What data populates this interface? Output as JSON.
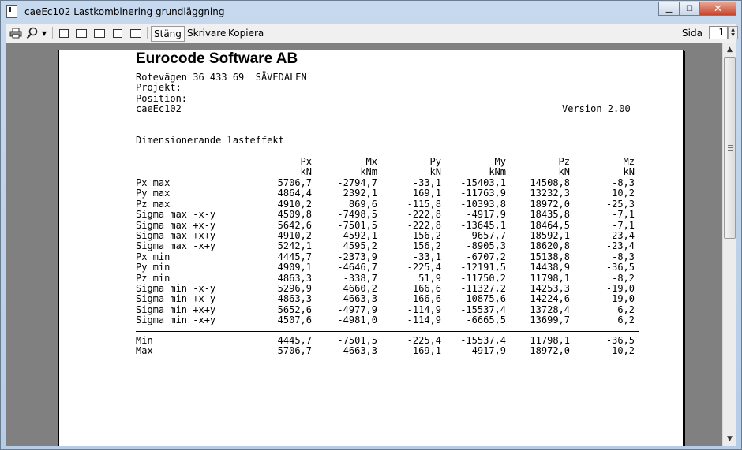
{
  "window": {
    "title": "caeEc102 Lastkombinering grundläggning"
  },
  "toolbar": {
    "close_label": "Stäng",
    "print_label": "Skrivare",
    "copy_label": "Kopiera",
    "page_label": "Sida",
    "page_value": "1"
  },
  "report": {
    "company": "Eurocode Software AB",
    "address": "Rotevägen 36 433 69  SÄVEDALEN",
    "project": "Projekt:",
    "position": "Position:",
    "program": "caeEc102",
    "version": "Version 2.00",
    "section_title": "Dimensionerande lasteffekt",
    "columns": [
      {
        "name": "Px",
        "unit": "kN"
      },
      {
        "name": "Mx",
        "unit": "kNm"
      },
      {
        "name": "Py",
        "unit": "kN"
      },
      {
        "name": "My",
        "unit": "kNm"
      },
      {
        "name": "Pz",
        "unit": "kN"
      },
      {
        "name": "Mz",
        "unit": "kN"
      }
    ],
    "rows": [
      {
        "label": "Px max",
        "values": [
          "5706,7",
          "-2794,7",
          "-33,1",
          "-15403,1",
          "14508,8",
          "-8,3"
        ]
      },
      {
        "label": "Py max",
        "values": [
          "4864,4",
          "2392,1",
          "169,1",
          "-11763,9",
          "13232,3",
          "10,2"
        ]
      },
      {
        "label": "Pz max",
        "values": [
          "4910,2",
          "869,6",
          "-115,8",
          "-10393,8",
          "18972,0",
          "-25,3"
        ]
      },
      {
        "label": "Sigma max -x-y",
        "values": [
          "4509,8",
          "-7498,5",
          "-222,8",
          "-4917,9",
          "18435,8",
          "-7,1"
        ]
      },
      {
        "label": "Sigma max +x-y",
        "values": [
          "5642,6",
          "-7501,5",
          "-222,8",
          "-13645,1",
          "18464,5",
          "-7,1"
        ]
      },
      {
        "label": "Sigma max +x+y",
        "values": [
          "4910,2",
          "4592,1",
          "156,2",
          "-9657,7",
          "18592,1",
          "-23,4"
        ]
      },
      {
        "label": "Sigma max -x+y",
        "values": [
          "5242,1",
          "4595,2",
          "156,2",
          "-8905,3",
          "18620,8",
          "-23,4"
        ]
      },
      {
        "label": "Px min",
        "values": [
          "4445,7",
          "-2373,9",
          "-33,1",
          "-6707,2",
          "15138,8",
          "-8,3"
        ]
      },
      {
        "label": "Py min",
        "values": [
          "4909,1",
          "-4646,7",
          "-225,4",
          "-12191,5",
          "14438,9",
          "-36,5"
        ]
      },
      {
        "label": "Pz min",
        "values": [
          "4863,3",
          "-338,7",
          "51,9",
          "-11750,2",
          "11798,1",
          "-8,2"
        ]
      },
      {
        "label": "Sigma min -x-y",
        "values": [
          "5296,9",
          "4660,2",
          "166,6",
          "-11327,2",
          "14253,3",
          "-19,0"
        ]
      },
      {
        "label": "Sigma min +x-y",
        "values": [
          "4863,3",
          "4663,3",
          "166,6",
          "-10875,6",
          "14224,6",
          "-19,0"
        ]
      },
      {
        "label": "Sigma min +x+y",
        "values": [
          "5652,6",
          "-4977,9",
          "-114,9",
          "-15537,4",
          "13728,4",
          "6,2"
        ]
      },
      {
        "label": "Sigma min -x+y",
        "values": [
          "4507,6",
          "-4981,0",
          "-114,9",
          "-6665,5",
          "13699,7",
          "6,2"
        ]
      }
    ],
    "summary": [
      {
        "label": "Min",
        "values": [
          "4445,7",
          "-7501,5",
          "-225,4",
          "-15537,4",
          "11798,1",
          "-36,5"
        ]
      },
      {
        "label": "Max",
        "values": [
          "5706,7",
          "4663,3",
          "169,1",
          "-4917,9",
          "18972,0",
          "10,2"
        ]
      }
    ]
  }
}
